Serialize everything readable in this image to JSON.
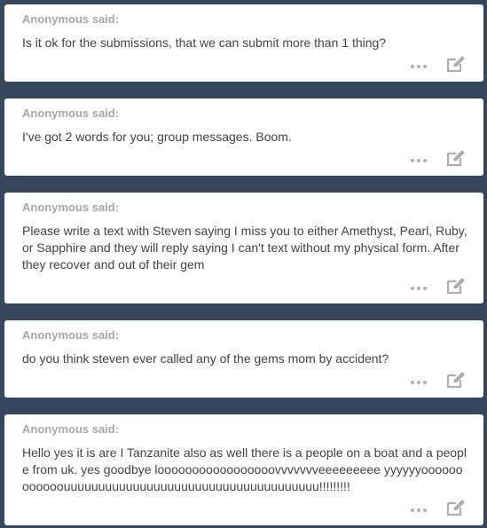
{
  "colors": {
    "background": "#36465d",
    "card": "#ffffff",
    "asker": "#a8a8a8",
    "text": "#444444",
    "icon": "#b0b0b0"
  },
  "icons": {
    "more": "more-dots-icon",
    "edit": "edit-pencil-icon"
  },
  "asks": [
    {
      "asker_label": "Anonymous said:",
      "question": "Is it ok for the submissions, that we can submit more than 1 thing?"
    },
    {
      "asker_label": "Anonymous said:",
      "question": "I've got 2 words for you; group messages. Boom."
    },
    {
      "asker_label": "Anonymous said:",
      "question": "Please write a text with Steven saying I miss you to either Amethyst, Pearl, Ruby, or Sapphire and they will reply saying I can't text without my physical form. After they recover and out of their gem"
    },
    {
      "asker_label": "Anonymous said:",
      "question": "do you think steven ever called any of the gems mom by accident?"
    },
    {
      "asker_label": "Anonymous said:",
      "question": "Hello yes it is are I Tanzanite also as well there is a people on a boat and a people from uk. yes goodbye looooooooooooooooovvvvvvveeeeeeeee yyyyyyoooooooooooouuuuuuuuuuuuuuuuuuuuuuuuuuuuuuuuuuuuu!!!!!!!!!"
    }
  ]
}
